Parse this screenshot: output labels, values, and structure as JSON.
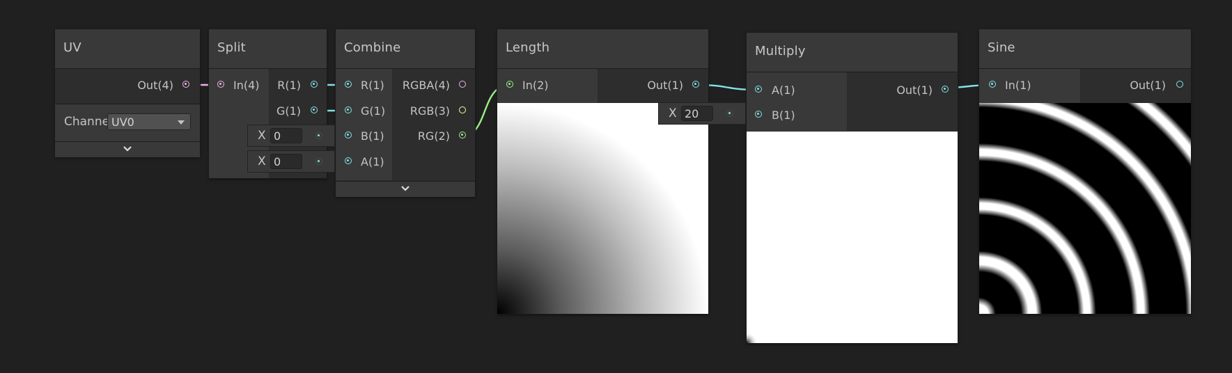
{
  "colors": {
    "background": "#202020",
    "node_body": "#2b2b2b",
    "node_header": "#393939",
    "vector1_port": "#84e4e7",
    "vector2_port": "#9cf088",
    "vector3_port": "#f6ff9a",
    "vector4_port": "#f0b4eb"
  },
  "nodes": {
    "uv": {
      "title": "UV",
      "outputs": [
        "Out(4)"
      ],
      "channel_label": "Channe",
      "channel_value": "UV0"
    },
    "split": {
      "title": "Split",
      "inputs": [
        "In(4)"
      ],
      "outputs": [
        "R(1)",
        "G(1)"
      ]
    },
    "combine": {
      "title": "Combine",
      "inputs": [
        "R(1)",
        "G(1)",
        "B(1)",
        "A(1)"
      ],
      "outputs": [
        "RGBA(4)",
        "RGB(3)",
        "RG(2)"
      ],
      "inline_b": {
        "label": "X",
        "value": "0"
      },
      "inline_a": {
        "label": "X",
        "value": "0"
      }
    },
    "length": {
      "title": "Length",
      "inputs": [
        "In(2)"
      ],
      "outputs": [
        "Out(1)"
      ]
    },
    "multiply": {
      "title": "Multiply",
      "inputs": [
        "A(1)",
        "B(1)"
      ],
      "outputs": [
        "Out(1)"
      ],
      "inline_b": {
        "label": "X",
        "value": "20"
      }
    },
    "sine": {
      "title": "Sine",
      "inputs": [
        "In(1)"
      ],
      "outputs": [
        "Out(1)"
      ]
    }
  }
}
